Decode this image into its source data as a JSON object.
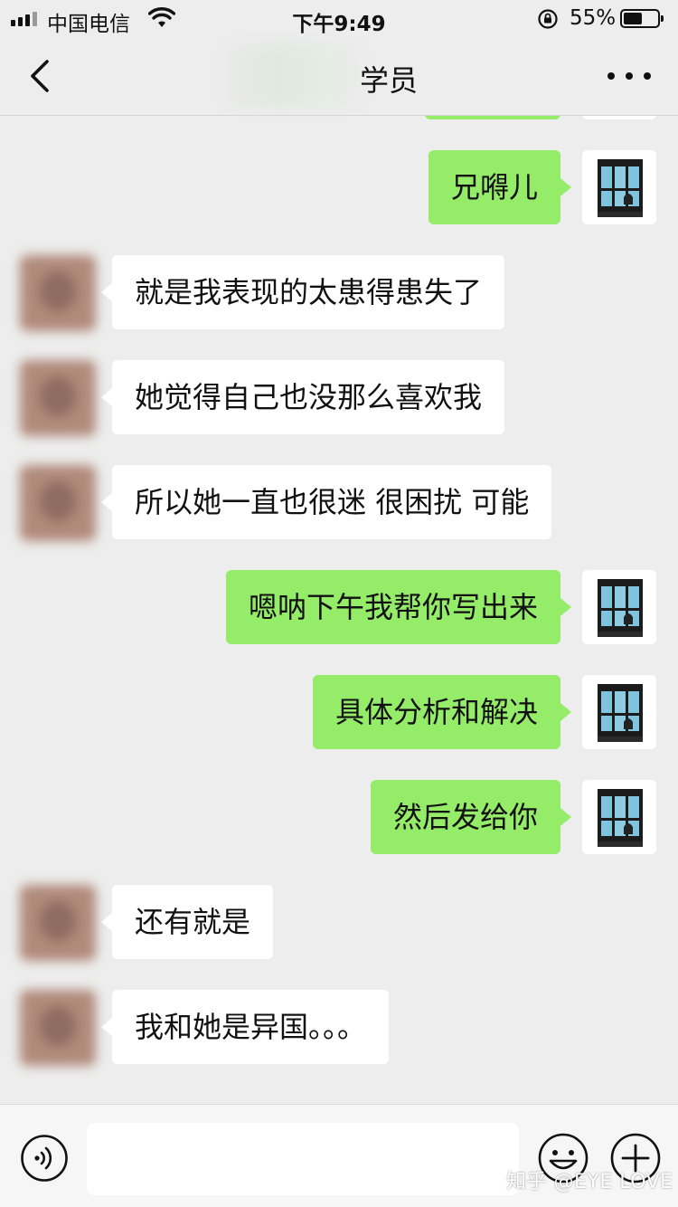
{
  "status_bar": {
    "carrier": "中国电信",
    "time": "下午9:49",
    "battery_percent_label": "55%",
    "battery_level": 0.55
  },
  "nav": {
    "title": "学员"
  },
  "colors": {
    "background": "#ededed",
    "sent_bubble": "#95ec69",
    "received_bubble": "#ffffff"
  },
  "messages": [
    {
      "side": "sent",
      "text": "兄嘚儿"
    },
    {
      "side": "received",
      "text": "就是我表现的太患得患失了"
    },
    {
      "side": "received",
      "text": "她觉得自己也没那么喜欢我"
    },
    {
      "side": "received",
      "text": "所以她一直也很迷 很困扰 可能"
    },
    {
      "side": "sent",
      "text": "嗯呐下午我帮你写出来"
    },
    {
      "side": "sent",
      "text": "具体分析和解决"
    },
    {
      "side": "sent",
      "text": "然后发给你"
    },
    {
      "side": "received",
      "text": "还有就是"
    },
    {
      "side": "received",
      "text": "我和她是异国。。。"
    }
  ],
  "input": {
    "value": "",
    "placeholder": ""
  },
  "icons": [
    "signal-icon",
    "wifi-icon",
    "orientation-lock-icon",
    "battery-icon",
    "back-chevron-icon",
    "more-dots-icon",
    "voice-icon",
    "emoji-icon",
    "plus-icon"
  ],
  "watermark": "知乎 @EYE LOVE"
}
